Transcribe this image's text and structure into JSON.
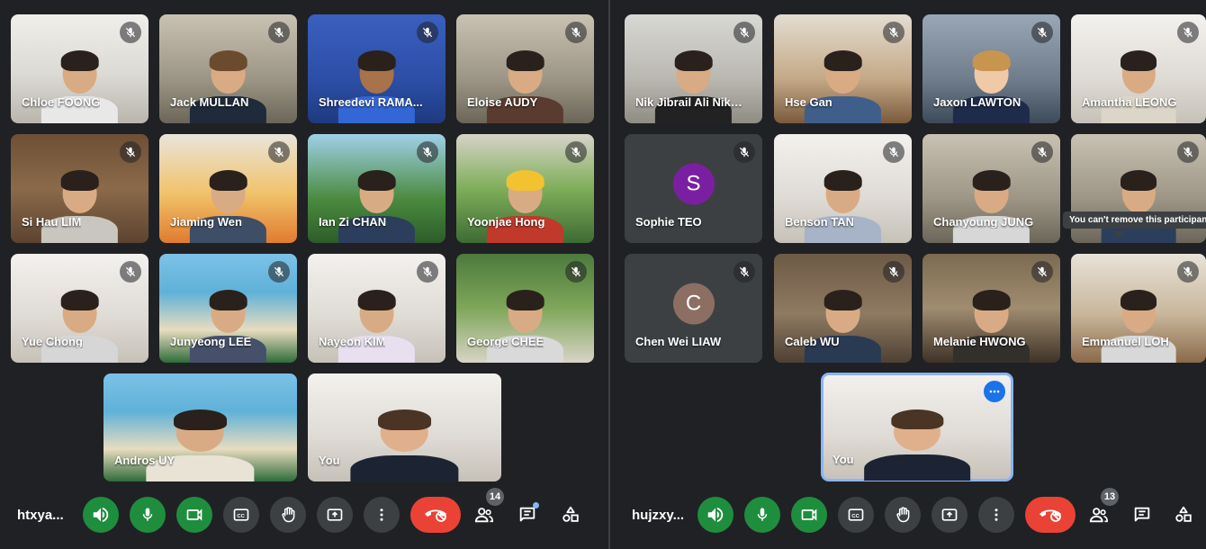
{
  "colors": {
    "background": "#202124",
    "tile": "#3c4043",
    "green_button": "#1e8e3e",
    "red_button": "#ea4335",
    "active_outline": "#8ab4f8"
  },
  "left": {
    "meeting_code": "htxya...",
    "participant_count": "14",
    "tiles": [
      {
        "name": "Chloe FOONG",
        "muted": true
      },
      {
        "name": "Jack MULLAN",
        "muted": true
      },
      {
        "name": "Shreedevi RAMA...",
        "muted": true
      },
      {
        "name": "Eloise AUDY",
        "muted": true
      },
      {
        "name": "Si Hau LIM",
        "muted": true
      },
      {
        "name": "Jiaming Wen",
        "muted": true
      },
      {
        "name": "Ian Zi CHAN",
        "muted": true
      },
      {
        "name": "Yoonjae Hong",
        "muted": true
      },
      {
        "name": "Yue Chong",
        "muted": true
      },
      {
        "name": "Junyeong LEE",
        "muted": true
      },
      {
        "name": "Nayeon KIM",
        "muted": true
      },
      {
        "name": "George CHEE",
        "muted": true
      },
      {
        "name": "Andros UY",
        "muted": false
      },
      {
        "name": "You",
        "muted": false
      }
    ]
  },
  "right": {
    "meeting_code": "hujzxy...",
    "participant_count": "13",
    "tooltip": "You can't remove this participant",
    "tiles": [
      {
        "name": "Nik Jibrail Ali Nik ...",
        "muted": true
      },
      {
        "name": "Hse Gan",
        "muted": true
      },
      {
        "name": "Jaxon LAWTON",
        "muted": true
      },
      {
        "name": "Amantha LEONG",
        "muted": true
      },
      {
        "name": "Sophie TEO",
        "muted": true,
        "avatar_letter": "S",
        "avatar_color": "#7b1fa2"
      },
      {
        "name": "Benson TAN",
        "muted": true
      },
      {
        "name": "Chanyoung JUNG",
        "muted": true
      },
      {
        "name": "",
        "muted": true
      },
      {
        "name": "Chen Wei LIAW",
        "muted": true,
        "avatar_letter": "C",
        "avatar_color": "#8d6e63"
      },
      {
        "name": "Caleb WU",
        "muted": true
      },
      {
        "name": "Melanie HWONG",
        "muted": true
      },
      {
        "name": "Emmanuel LOH",
        "muted": true
      },
      {
        "name": "You",
        "muted": false
      }
    ]
  },
  "icons": {
    "speaker": "volume-icon",
    "mic": "mic-icon",
    "camera": "camera-icon",
    "captions": "captions-icon",
    "hand": "raise-hand-icon",
    "present": "present-screen-icon",
    "more": "more-vert-icon",
    "leave": "leave-call-icon",
    "people": "people-icon",
    "chat": "chat-icon",
    "activities": "activities-icon"
  }
}
